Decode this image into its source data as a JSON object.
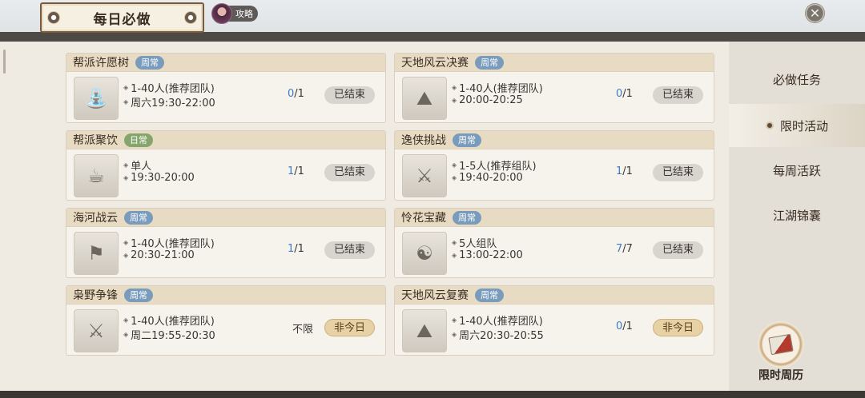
{
  "window": {
    "title": "每日必做",
    "guide_label": "攻略",
    "close_icon": "close-icon"
  },
  "colors": {
    "tag_weekly": "#7a9cbc",
    "tag_daily": "#86a56c",
    "progress_current": "#3d7bbf"
  },
  "cards": [
    {
      "title": "帮派许愿树",
      "tag": "周常",
      "tag_type": "weekly",
      "icon": "wishing-tree-icon",
      "line1": "1-40人(推荐团队)",
      "line2": "周六19:30-22:00",
      "progress_current": "0",
      "progress_total": "/1",
      "status": "已结束",
      "status_type": "ended"
    },
    {
      "title": "天地风云决赛",
      "tag": "周常",
      "tag_type": "weekly",
      "icon": "mountain-arena-icon",
      "line1": "1-40人(推荐团队)",
      "line2": "20:00-20:25",
      "progress_current": "0",
      "progress_total": "/1",
      "status": "已结束",
      "status_type": "ended"
    },
    {
      "title": "帮派聚饮",
      "tag": "日常",
      "tag_type": "daily",
      "icon": "feast-icon",
      "line1": "单人",
      "line2": "19:30-20:00",
      "progress_current": "1",
      "progress_total": "/1",
      "status": "已结束",
      "status_type": "ended"
    },
    {
      "title": "逸侠挑战",
      "tag": "周常",
      "tag_type": "weekly",
      "icon": "warrior-statue-icon",
      "line1": "1-5人(推荐组队)",
      "line2": "19:40-20:00",
      "progress_current": "1",
      "progress_total": "/1",
      "status": "已结束",
      "status_type": "ended"
    },
    {
      "title": "海河战云",
      "tag": "周常",
      "tag_type": "weekly",
      "icon": "battlefield-icon",
      "line1": "1-40人(推荐团队)",
      "line2": "20:30-21:00",
      "progress_current": "1",
      "progress_total": "/1",
      "status": "已结束",
      "status_type": "ended"
    },
    {
      "title": "怜花宝藏",
      "tag": "周常",
      "tag_type": "weekly",
      "icon": "treasure-compass-icon",
      "line1": "5人组队",
      "line2": "13:00-22:00",
      "progress_current": "7",
      "progress_total": "/7",
      "status": "已结束",
      "status_type": "ended"
    },
    {
      "title": "枭野争锋",
      "tag": "周常",
      "tag_type": "weekly",
      "icon": "crossed-swords-icon",
      "line1": "1-40人(推荐团队)",
      "line2": "周二19:55-20:30",
      "progress_label": "不限",
      "status": "非今日",
      "status_type": "notoday"
    },
    {
      "title": "天地风云复赛",
      "tag": "周常",
      "tag_type": "weekly",
      "icon": "mountain-arena-icon",
      "line1": "1-40人(推荐团队)",
      "line2": "周六20:30-20:55",
      "progress_current": "0",
      "progress_total": "/1",
      "status": "非今日",
      "status_type": "notoday"
    }
  ],
  "sidebar": {
    "tabs": [
      {
        "label": "必做任务",
        "active": false
      },
      {
        "label": "限时活动",
        "active": true
      },
      {
        "label": "每周活跃",
        "active": false
      },
      {
        "label": "江湖锦囊",
        "active": false
      }
    ],
    "calendar_label": "限时周历",
    "calendar_icon": "scroll-calendar-icon"
  }
}
